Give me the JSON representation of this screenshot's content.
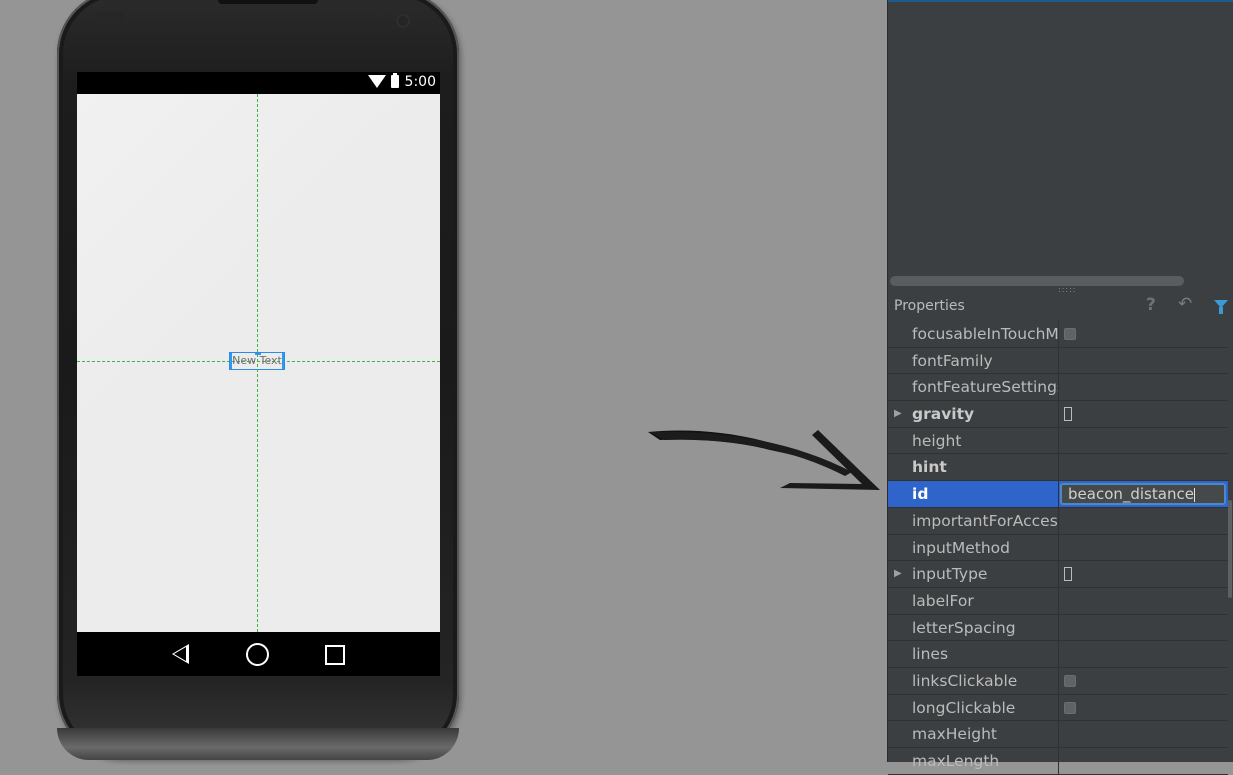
{
  "device": {
    "status_time": "5:00",
    "textview_text": "New Text",
    "nav": {
      "back_icon": "back-triangle",
      "home_icon": "home-circle",
      "recents_icon": "recents-square"
    }
  },
  "panel": {
    "title": "Properties",
    "icons": [
      "help-icon",
      "restore-icon",
      "filter-icon"
    ],
    "accent": "#2f65ca",
    "properties": [
      {
        "name": "focusableInTouchMode",
        "bold": false,
        "expandable": false,
        "value_type": "checkbox",
        "value": ""
      },
      {
        "name": "fontFamily",
        "bold": false,
        "expandable": false,
        "value_type": "text",
        "value": ""
      },
      {
        "name": "fontFeatureSettings",
        "bold": false,
        "expandable": false,
        "value_type": "text",
        "value": ""
      },
      {
        "name": "gravity",
        "bold": true,
        "expandable": true,
        "value_type": "glyph",
        "value": ""
      },
      {
        "name": "height",
        "bold": false,
        "expandable": false,
        "value_type": "text",
        "value": ""
      },
      {
        "name": "hint",
        "bold": true,
        "expandable": false,
        "value_type": "text",
        "value": ""
      },
      {
        "name": "id",
        "bold": true,
        "expandable": false,
        "value_type": "input",
        "value": "beacon_distance",
        "selected": true
      },
      {
        "name": "importantForAccessibility",
        "bold": false,
        "expandable": false,
        "value_type": "text",
        "value": ""
      },
      {
        "name": "inputMethod",
        "bold": false,
        "expandable": false,
        "value_type": "text",
        "value": ""
      },
      {
        "name": "inputType",
        "bold": false,
        "expandable": true,
        "value_type": "glyph",
        "value": ""
      },
      {
        "name": "labelFor",
        "bold": false,
        "expandable": false,
        "value_type": "text",
        "value": ""
      },
      {
        "name": "letterSpacing",
        "bold": false,
        "expandable": false,
        "value_type": "text",
        "value": ""
      },
      {
        "name": "lines",
        "bold": false,
        "expandable": false,
        "value_type": "text",
        "value": ""
      },
      {
        "name": "linksClickable",
        "bold": false,
        "expandable": false,
        "value_type": "checkbox",
        "value": ""
      },
      {
        "name": "longClickable",
        "bold": false,
        "expandable": false,
        "value_type": "checkbox",
        "value": ""
      },
      {
        "name": "maxHeight",
        "bold": false,
        "expandable": false,
        "value_type": "text",
        "value": ""
      },
      {
        "name": "maxLength",
        "bold": false,
        "expandable": false,
        "value_type": "text",
        "value": ""
      }
    ]
  }
}
